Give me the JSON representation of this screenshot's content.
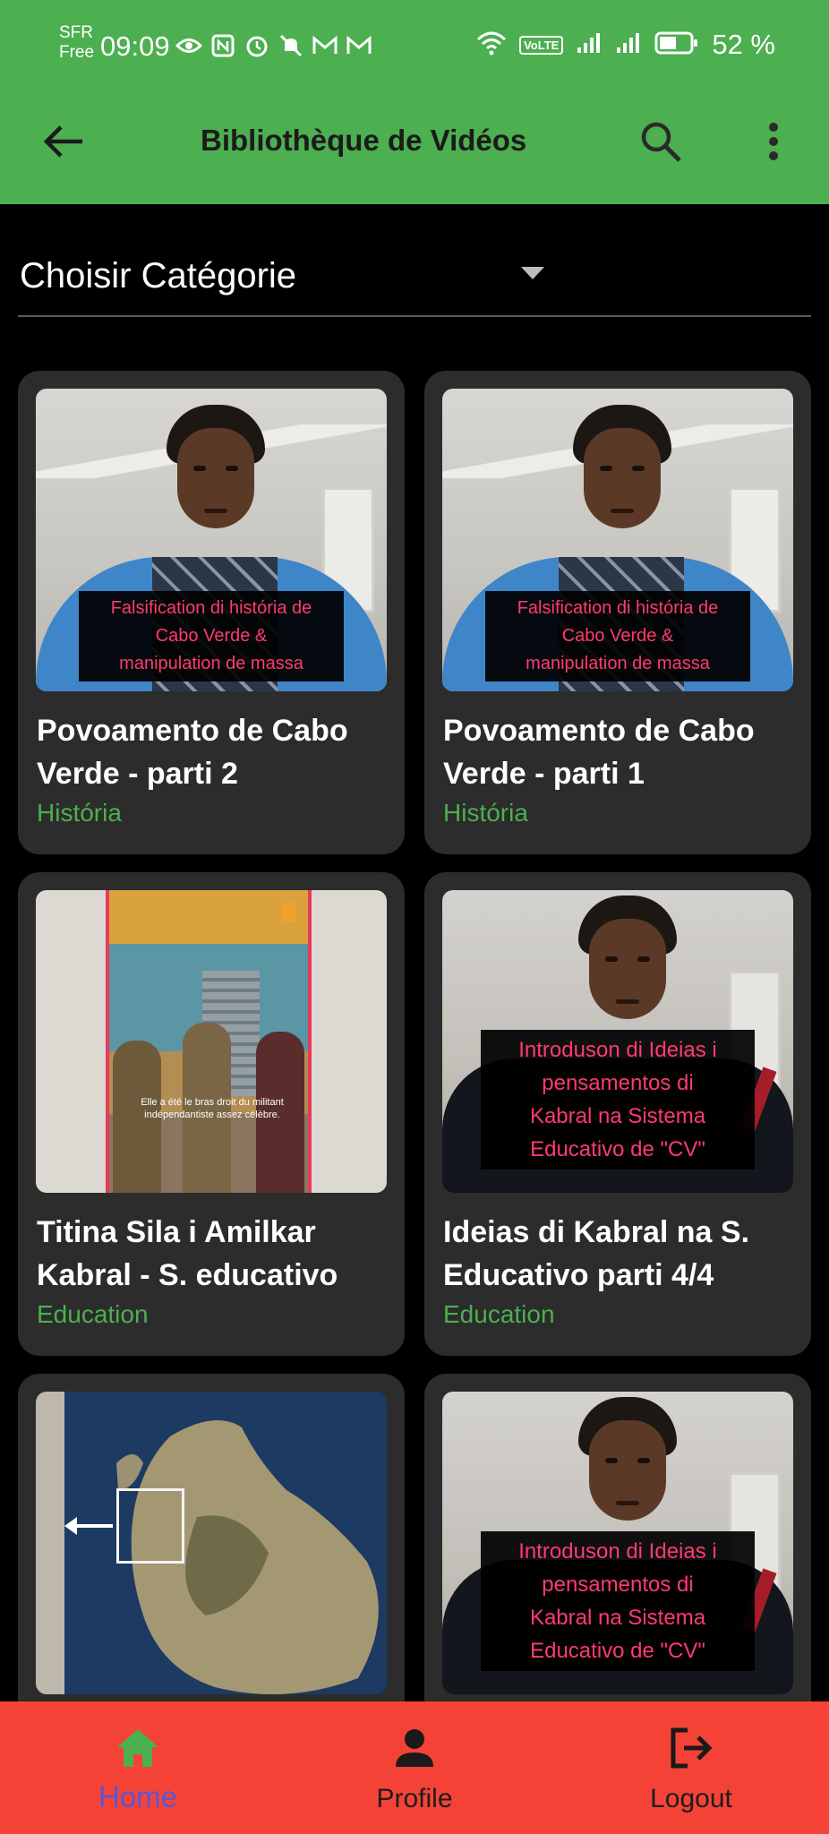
{
  "status_bar": {
    "carrier_line1": "SFR",
    "carrier_line2": "Free",
    "time": "09:09",
    "volte": "VoLTE",
    "battery": "52 %"
  },
  "app_bar": {
    "title": "Bibliothèque de Vidéos",
    "icons": [
      "back-arrow-icon",
      "search-icon",
      "more-vert-icon"
    ]
  },
  "category_select": {
    "label": "Choisir Catégorie"
  },
  "videos": [
    {
      "title": "Povoamento de Cabo Verde - parti 2",
      "category": "História",
      "caption": [
        "Falsification di história de",
        "Cabo Verde &",
        "manipulation de massa"
      ]
    },
    {
      "title": "Povoamento de Cabo Verde - parti 1",
      "category": "História",
      "caption": [
        "Falsification di história de",
        "Cabo Verde &",
        "manipulation de massa"
      ]
    },
    {
      "title": "Titina Sila i Amilkar Kabral - S. educativo",
      "category": "Education",
      "caption": [
        "Elle a été le bras droit du militant",
        "indépendantiste assez célèbre."
      ]
    },
    {
      "title": "Ideias di Kabral na S. Educativo parti 4/4",
      "category": "Education",
      "caption": [
        "Introduson di Ideias i",
        "pensamentos di",
        "Kabral na Sistema",
        "Educativo de \"CV\""
      ]
    },
    {
      "title": "",
      "category": "",
      "caption": []
    },
    {
      "title": "",
      "category": "",
      "caption": [
        "Introduson di Ideias i",
        "pensamentos di",
        "Kabral na Sistema",
        "Educativo de \"CV\""
      ]
    }
  ],
  "bottom_nav": {
    "items": [
      {
        "label": "Home",
        "icon": "home-icon",
        "active": true
      },
      {
        "label": "Profile",
        "icon": "person-icon",
        "active": false
      },
      {
        "label": "Logout",
        "icon": "logout-icon",
        "active": false
      }
    ]
  },
  "colors": {
    "app_bar": "#4CAF50",
    "bottom_nav": "#F44336",
    "card": "#2c2c2c",
    "category_text": "#4CAF50",
    "caption_text": "#ff3b6e",
    "active_nav": "#5a55d6"
  }
}
